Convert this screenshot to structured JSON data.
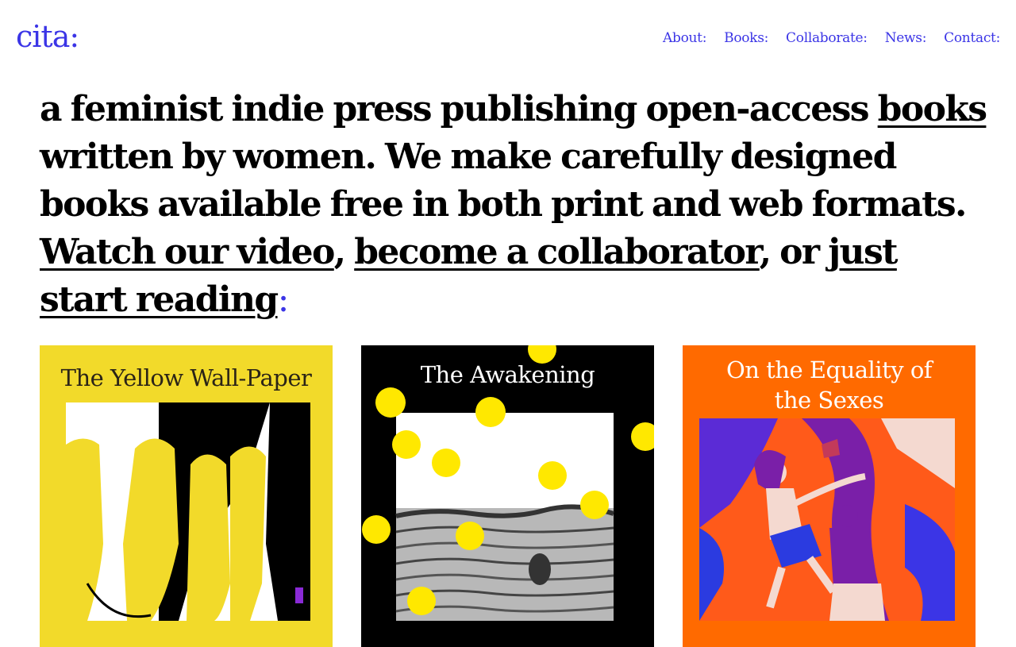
{
  "header": {
    "logo": "cita:",
    "nav": [
      "About:",
      "Books:",
      "Collaborate:",
      "News:",
      "Contact:"
    ]
  },
  "hero": {
    "text_1": "a feminist indie press publishing open-access ",
    "link_books": "books",
    "text_2": " written by women. We make carefully designed books available free in both print and web formats. ",
    "link_video": "Watch our video",
    "text_3": ", ",
    "link_collab": "become a collaborator",
    "text_4": ", or ",
    "link_reading": "just start reading",
    "colon": ":"
  },
  "books": [
    {
      "title": "The Yellow Wall-Paper",
      "bg": "#f2da2a",
      "title_color": "#2b2417"
    },
    {
      "title": "The Awakening",
      "bg": "#000000",
      "title_color": "#ffffff"
    },
    {
      "title_line1": "On the Equality of",
      "title_line2": "the Sexes",
      "bg": "#ff6a00",
      "title_color": "#ffffff"
    }
  ],
  "colors": {
    "accent": "#3b35e6"
  }
}
